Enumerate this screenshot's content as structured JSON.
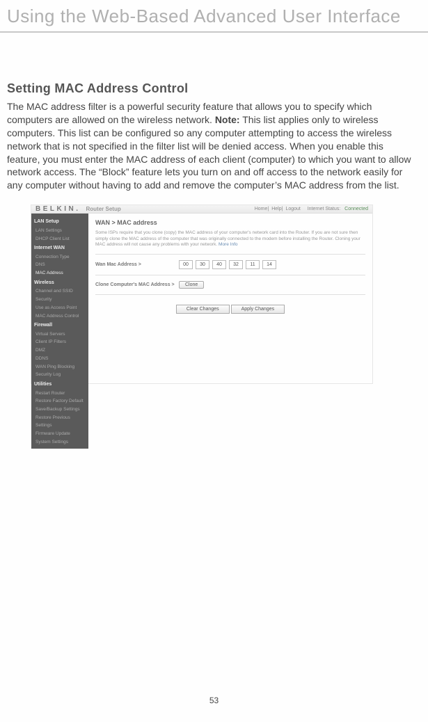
{
  "header": {
    "title": "Using the Web-Based Advanced User Interface"
  },
  "section": {
    "title": "Setting MAC Address Control",
    "intro": "The MAC address filter is a powerful security feature that allows you to specify which computers are allowed on the wireless network. ",
    "note_label": "Note:",
    "note_body": " This list applies only to wireless computers. This list can be configured so any computer attempting to access the wireless network that is not specified in the filter list will be denied access. When you enable this feature, you must enter the MAC address of each client (computer) to which you want to allow network access. The “Block” feature lets you turn on and off access to the network easily for any computer without having to add and remove the computer’s MAC address from the list."
  },
  "router": {
    "brand": "BELKIN.",
    "brand_sub": "Router Setup",
    "toplinks": {
      "a": "Home",
      "b": "Help",
      "c": "Logout",
      "d": "Internet Status:",
      "e": "Connected"
    },
    "sidebar": {
      "h1": "LAN Setup",
      "i1": "LAN Settings",
      "i2": "DHCP Client List",
      "h2": "Internet WAN",
      "i3": "Connection Type",
      "i4": "DNS",
      "i5": "MAC Address",
      "h3": "Wireless",
      "i6": "Channel and SSID",
      "i7": "Security",
      "i8": "Use as Access Point",
      "i9": "MAC Address Control",
      "h4": "Firewall",
      "i10": "Virtual Servers",
      "i11": "Client IP Filters",
      "i12": "DMZ",
      "i13": "DDNS",
      "i14": "WAN Ping Blocking",
      "i15": "Security Log",
      "h5": "Utilities",
      "i16": "Restart Router",
      "i17": "Restore Factory Default",
      "i18": "Save/Backup Settings",
      "i19": "Restore Previous Settings",
      "i20": "Firmware Update",
      "i21": "System Settings"
    },
    "main": {
      "title": "WAN > MAC address",
      "desc": "Some ISPs require that you clone (copy) the MAC address of your computer's network card into the Router. If you are not sure then simply clone the MAC address of the computer that was originally connected to the modem before installing the Router. Cloning your MAC address will not cause any problems with your network.",
      "more": "More Info",
      "row1_label": "Wan Mac Address >",
      "mac": {
        "a": "00",
        "b": "30",
        "c": "40",
        "d": "32",
        "e": "11",
        "f": "14"
      },
      "row2_label": "Clone Computer's MAC Address >",
      "clone_btn": "Clone",
      "clear_btn": "Clear Changes",
      "apply_btn": "Apply Changes"
    }
  },
  "page_number": "53"
}
